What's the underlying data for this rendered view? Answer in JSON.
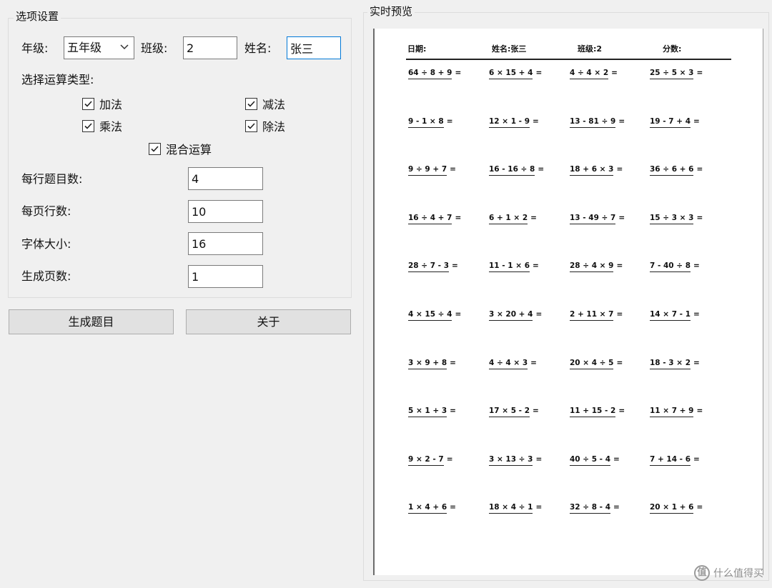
{
  "options": {
    "title": "选项设置",
    "grade": {
      "label": "年级:",
      "value": "五年级"
    },
    "class": {
      "label": "班级:",
      "value": "2"
    },
    "name": {
      "label": "姓名:",
      "value": "张三"
    },
    "op_type_label": "选择运算类型:",
    "checks": [
      {
        "label": "加法",
        "checked": true
      },
      {
        "label": "减法",
        "checked": true
      },
      {
        "label": "乘法",
        "checked": true
      },
      {
        "label": "除法",
        "checked": true
      },
      {
        "label": "混合运算",
        "checked": true
      }
    ],
    "per_row": {
      "label": "每行题目数:",
      "value": "4"
    },
    "rows_per_page": {
      "label": "每页行数:",
      "value": "10"
    },
    "font_size": {
      "label": "字体大小:",
      "value": "16"
    },
    "pages": {
      "label": "生成页数:",
      "value": "1"
    }
  },
  "buttons": {
    "generate": "生成题目",
    "about": "关于"
  },
  "preview": {
    "title": "实时预览",
    "header": {
      "date": "日期:",
      "name": "姓名:张三",
      "class": "班级:2",
      "score": "分数:"
    },
    "rows": [
      [
        "64 ÷ 8 + 9",
        "6 × 15 + 4",
        "4 ÷ 4 × 2",
        "25 ÷ 5 × 3"
      ],
      [
        "9 - 1 × 8",
        "12 × 1 - 9",
        "13 - 81 ÷ 9",
        "19 - 7 + 4"
      ],
      [
        "9 ÷ 9 + 7",
        "16 - 16 ÷ 8",
        "18 + 6 × 3",
        "36 ÷ 6 + 6"
      ],
      [
        "16 ÷ 4 + 7",
        "6 + 1 × 2",
        "13 - 49 ÷ 7",
        "15 ÷ 3 × 3"
      ],
      [
        "28 ÷ 7 - 3",
        "11 - 1 × 6",
        "28 ÷ 4 × 9",
        "7 - 40 ÷ 8"
      ],
      [
        "4 × 15 ÷ 4",
        "3 × 20 + 4",
        "2 + 11 × 7",
        "14 × 7 - 1"
      ],
      [
        "3 × 9 + 8",
        "4 ÷ 4 × 3",
        "20 × 4 ÷ 5",
        "18 - 3 × 2"
      ],
      [
        "5 × 1 + 3",
        "17 × 5 - 2",
        "11 + 15 - 2",
        "11 × 7 + 9"
      ],
      [
        "9 × 2 - 7",
        "3 × 13 ÷ 3",
        "40 ÷ 5 - 4",
        "7 + 14 - 6"
      ],
      [
        "1 × 4 + 6",
        "18 × 4 ÷ 1",
        "32 ÷ 8 - 4",
        "20 × 1 + 6"
      ]
    ],
    "equals": "="
  },
  "watermark": {
    "icon": "值",
    "text": "什么值得买"
  }
}
